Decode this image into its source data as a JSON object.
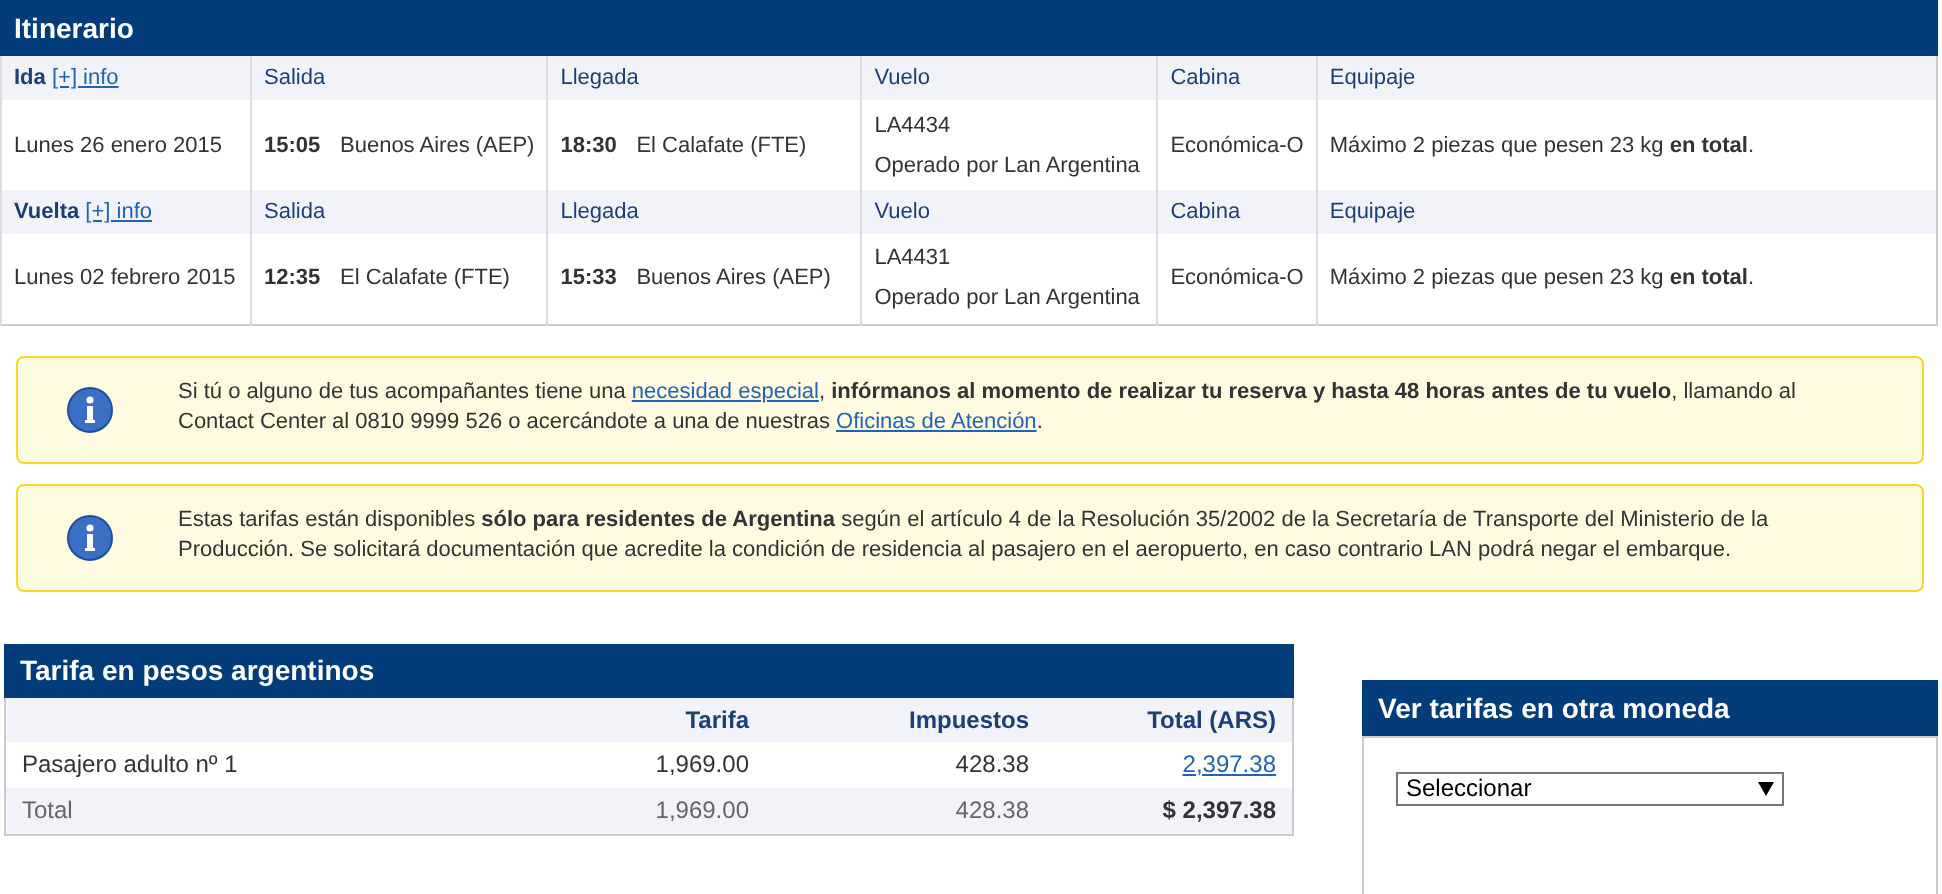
{
  "itinerary": {
    "title": "Itinerario",
    "legs": [
      {
        "direction": "Ida",
        "info_link": "[+] info",
        "headers": {
          "departure": "Salida",
          "arrival": "Llegada",
          "flight": "Vuelo",
          "cabin": "Cabina",
          "baggage": "Equipaje"
        },
        "date": "Lunes 26 enero 2015",
        "dep_time": "15:05",
        "dep_place": "Buenos Aires (AEP)",
        "arr_time": "18:30",
        "arr_place": "El Calafate (FTE)",
        "flight_number": "LA4434",
        "operated_by": "Operado por Lan Argentina",
        "cabin": "Económica-O",
        "baggage": "Máximo 2 piezas que pesen 23 kg **en total**."
      },
      {
        "direction": "Vuelta",
        "info_link": "[+] info",
        "headers": {
          "departure": "Salida",
          "arrival": "Llegada",
          "flight": "Vuelo",
          "cabin": "Cabina",
          "baggage": "Equipaje"
        },
        "date": "Lunes 02 febrero 2015",
        "dep_time": "12:35",
        "dep_place": "El Calafate (FTE)",
        "arr_time": "15:33",
        "arr_place": "Buenos Aires (AEP)",
        "flight_number": "LA4431",
        "operated_by": "Operado por Lan Argentina",
        "cabin": "Económica-O",
        "baggage": "Máximo 2 piezas que pesen 23 kg **en total**."
      }
    ]
  },
  "notices": [
    {
      "parts": [
        {
          "kind": "text",
          "text": "Si tú o alguno de tus acompañantes tiene una "
        },
        {
          "kind": "link",
          "text": "necesidad especial"
        },
        {
          "kind": "text",
          "text": ", "
        },
        {
          "kind": "bold",
          "text": "infórmanos al momento de realizar tu reserva y hasta 48 horas antes de tu vuelo"
        },
        {
          "kind": "text",
          "text": ", llamando al Contact Center al 0810 9999 526 o acercándote a una de nuestras "
        },
        {
          "kind": "link",
          "text": "Oficinas de Atención"
        },
        {
          "kind": "text",
          "text": "."
        }
      ]
    },
    {
      "parts": [
        {
          "kind": "text",
          "text": "Estas tarifas están disponibles "
        },
        {
          "kind": "bold",
          "text": "sólo para residentes de Argentina"
        },
        {
          "kind": "text",
          "text": " según el artículo 4 de la Resolución 35/2002 de la Secretaría de Transporte del Ministerio de la Producción. Se solicitará documentación que acredite la condición de residencia al pasajero en el aeropuerto, en caso contrario LAN podrá negar el embarque."
        }
      ]
    }
  ],
  "fares": {
    "title": "Tarifa en pesos argentinos",
    "columns": [
      "Tarifa",
      "Impuestos",
      "Total (ARS)"
    ],
    "rows": [
      {
        "kind": "passenger",
        "label": "Pasajero adulto nº 1",
        "fare": "1,969.00",
        "taxes": "428.38",
        "total": "2,397.38"
      },
      {
        "kind": "total",
        "label": "Total",
        "fare": "1,969.00",
        "taxes": "428.38",
        "total": "$ 2,397.38"
      }
    ]
  },
  "currency": {
    "title": "Ver tarifas en otra moneda",
    "select": {
      "value": "Seleccionar"
    }
  }
}
